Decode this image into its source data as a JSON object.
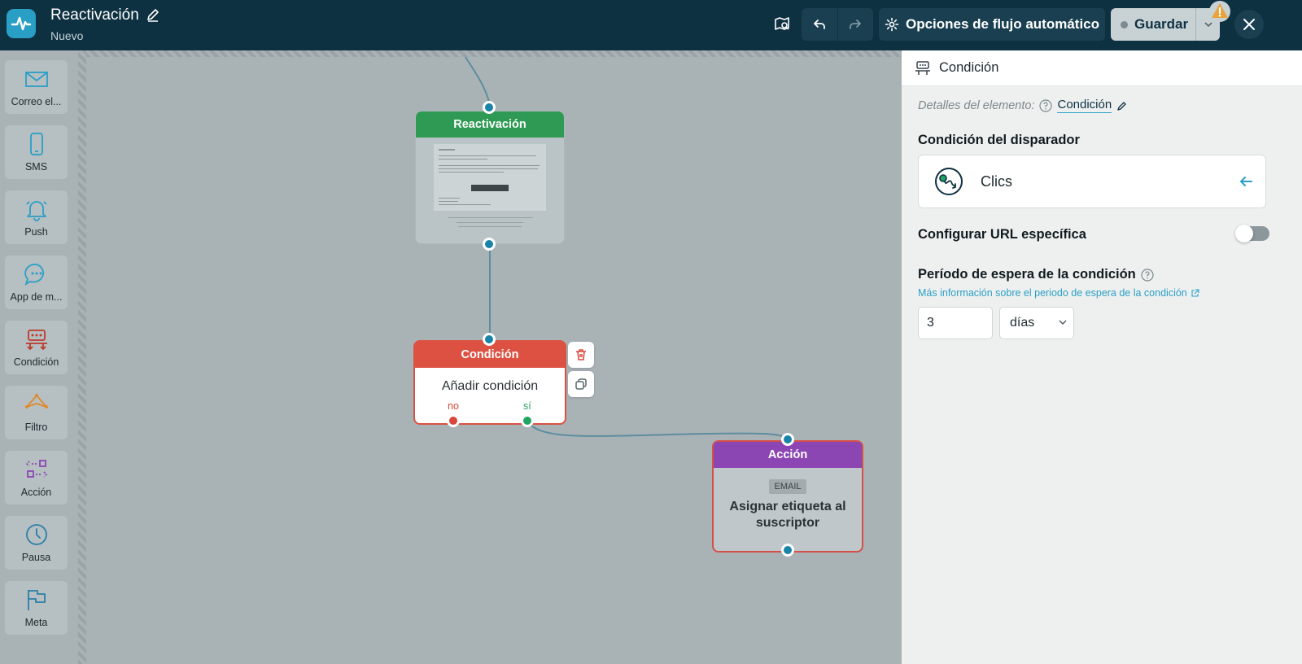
{
  "header": {
    "title": "Reactivación",
    "subtitle": "Nuevo",
    "options_label": "Opciones de flujo automático",
    "save_label": "Guardar"
  },
  "palette": {
    "items": [
      {
        "label": "Correo el...",
        "icon": "envelope-icon"
      },
      {
        "label": "SMS",
        "icon": "phone-icon"
      },
      {
        "label": "Push",
        "icon": "bell-icon"
      },
      {
        "label": "App de m...",
        "icon": "chat-bubble-icon"
      },
      {
        "label": "Condición",
        "icon": "condition-icon"
      },
      {
        "label": "Filtro",
        "icon": "filter-icon"
      },
      {
        "label": "Acción",
        "icon": "action-icon"
      },
      {
        "label": "Pausa",
        "icon": "clock-icon"
      },
      {
        "label": "Meta",
        "icon": "flag-icon"
      }
    ]
  },
  "canvas": {
    "reactivation_node": {
      "title": "Reactivación"
    },
    "condition_node": {
      "title": "Condición",
      "body": "Añadir condición",
      "branch_no": "no",
      "branch_yes": "sí"
    },
    "action_node": {
      "title": "Acción",
      "badge": "EMAIL",
      "text": "Asignar etiqueta al suscriptor"
    }
  },
  "panel": {
    "title": "Condición",
    "details_label": "Detalles del elemento:",
    "details_value": "Condición",
    "trigger_title": "Condición del disparador",
    "trigger_value": "Clics",
    "url_title": "Configurar URL específica",
    "url_toggle_on": false,
    "wait_title": "Período de espera de la condición",
    "wait_link": "Más información sobre el periodo de espera de la condición",
    "wait_value": "3",
    "wait_unit": "días"
  },
  "colors": {
    "topbar": "#0e3142",
    "accent": "#2a9fc6",
    "reactivation": "#2e9a53",
    "condition": "#dc5142",
    "action": "#8c46b3"
  }
}
